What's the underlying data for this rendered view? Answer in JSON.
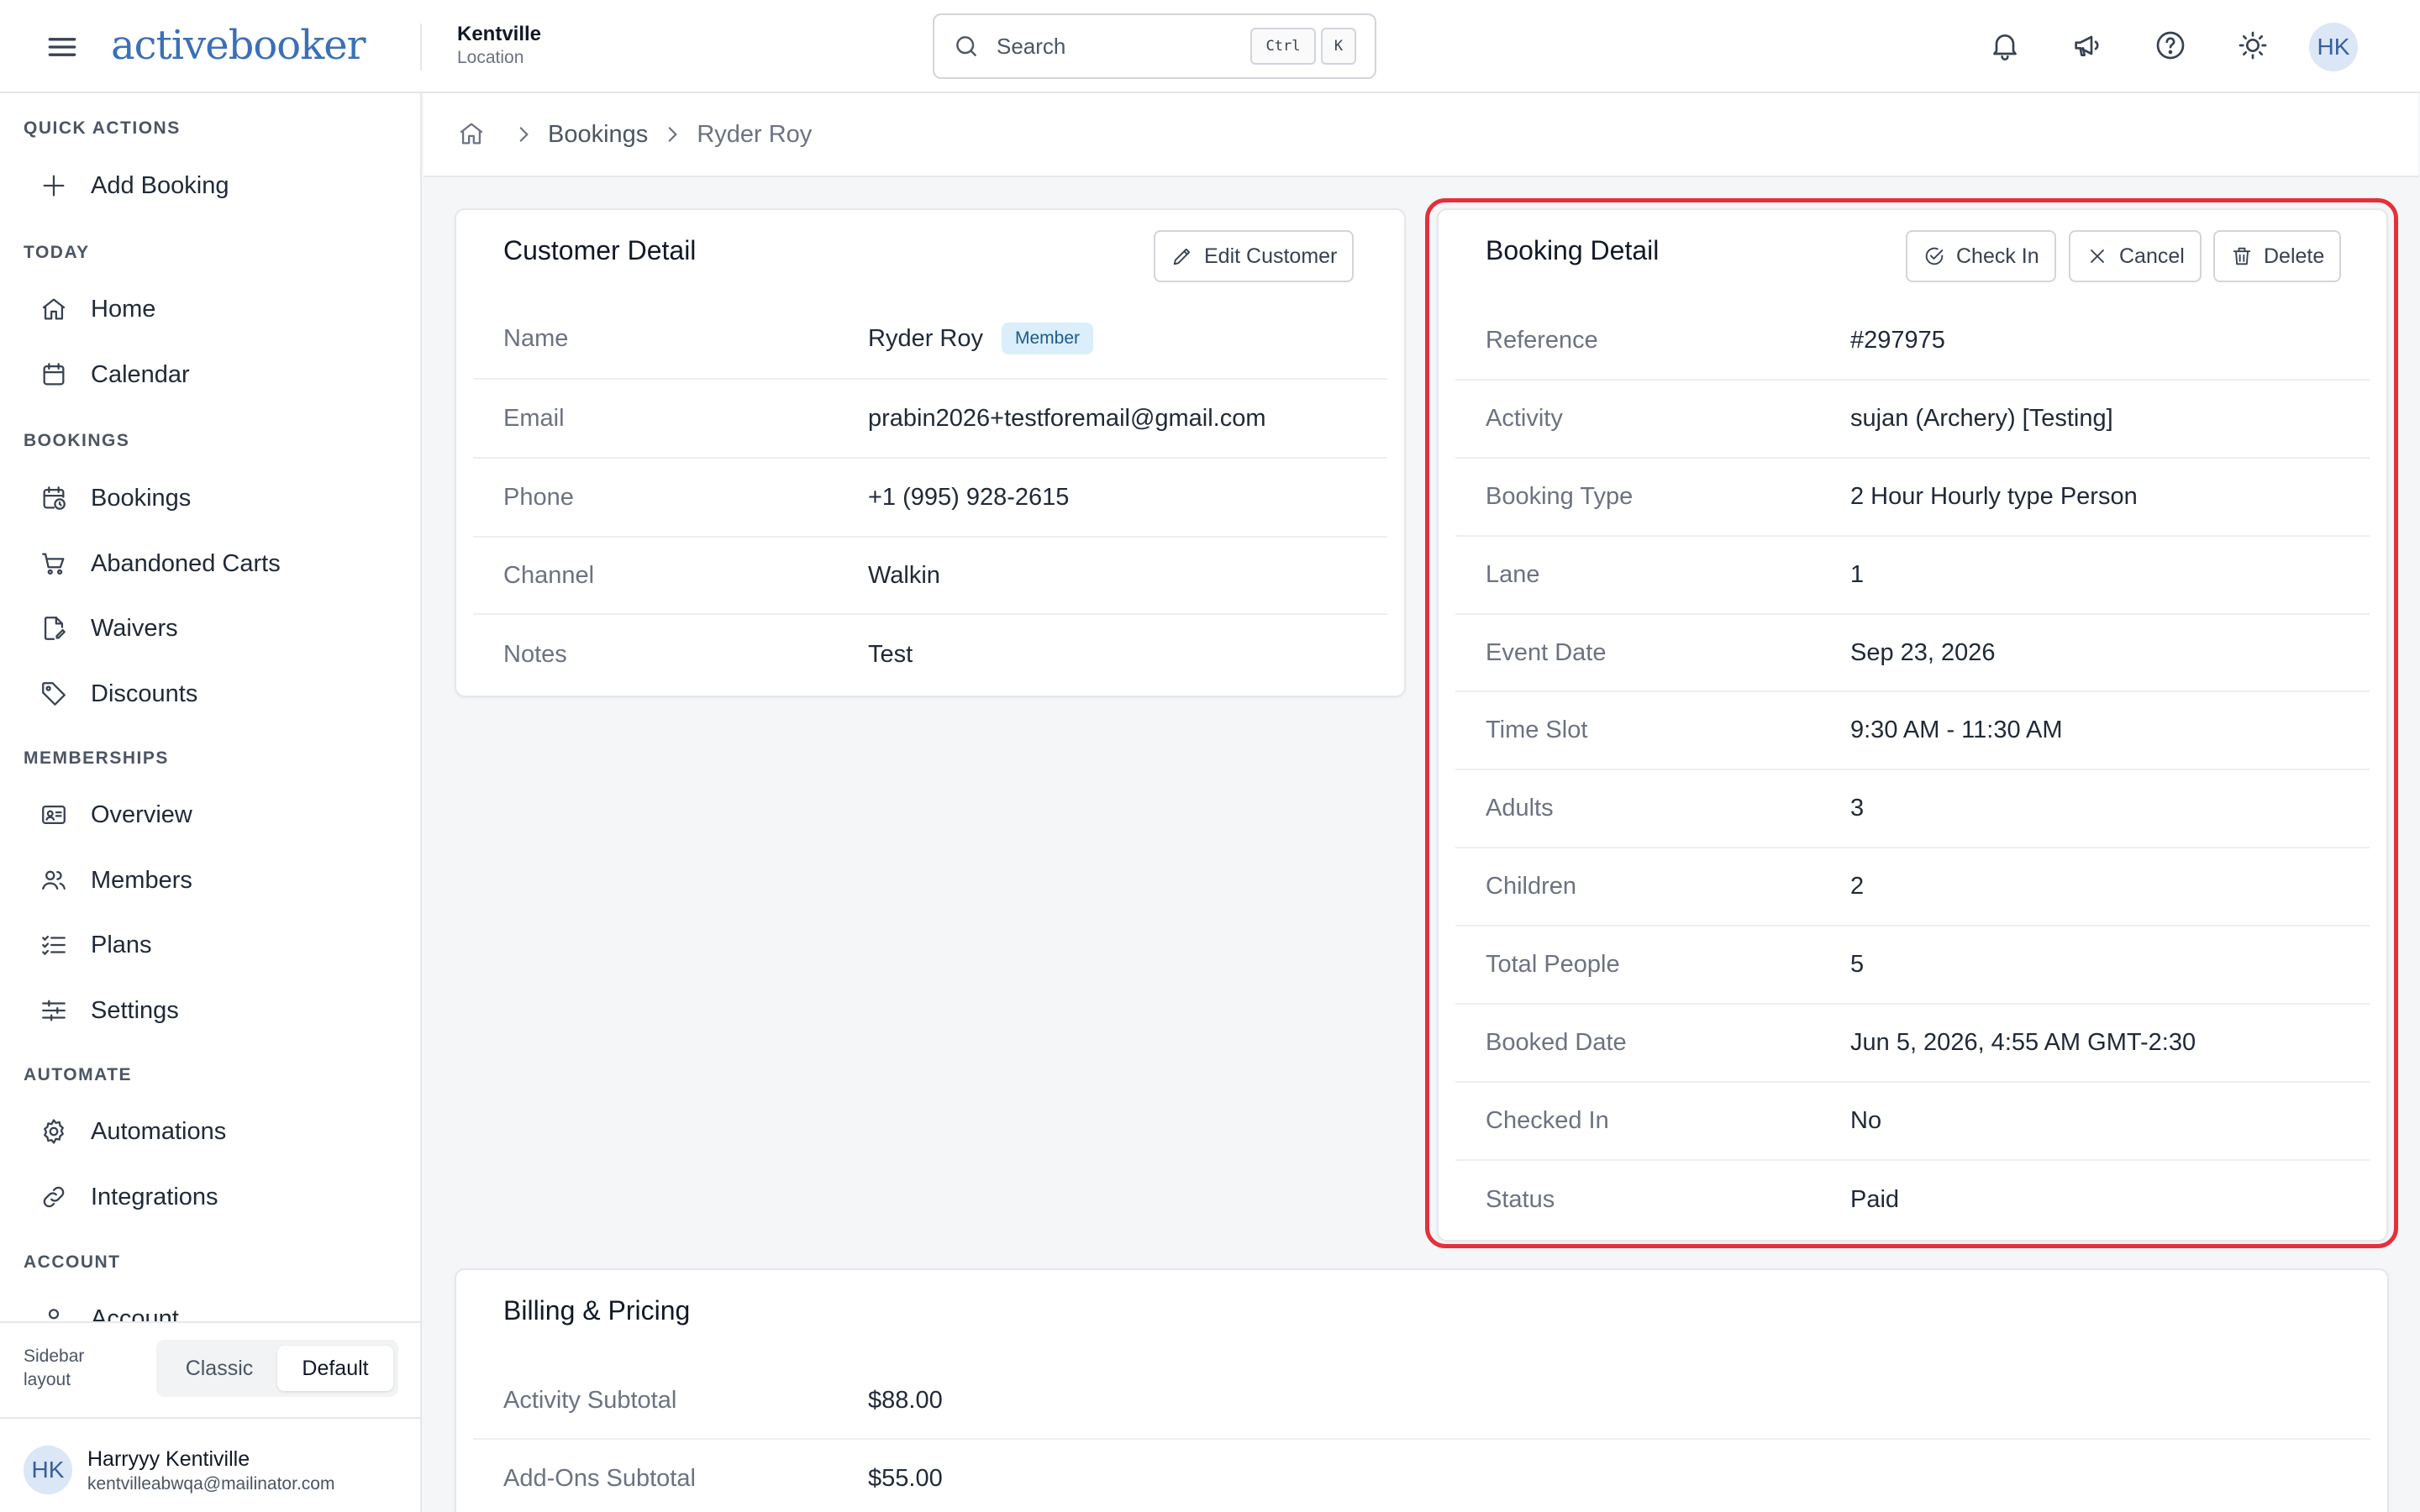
{
  "app": {
    "logo_text": "activebooker",
    "location_name": "Kentville",
    "location_sub": "Location"
  },
  "search": {
    "placeholder": "Search",
    "shortcut_ctrl": "Ctrl",
    "shortcut_key": "K"
  },
  "header_icons": [
    "bell-icon",
    "megaphone-icon",
    "help-icon",
    "sun-icon"
  ],
  "user": {
    "initials": "HK",
    "name": "Harryyy Kentiville",
    "email": "kentvilleabwqa@mailinator.com"
  },
  "sidebar": {
    "sections": {
      "quick_actions": "QUICK ACTIONS",
      "today": "TODAY",
      "bookings": "BOOKINGS",
      "memberships": "MEMBERSHIPS",
      "automate": "AUTOMATE",
      "account": "ACCOUNT"
    },
    "items": {
      "add_booking": "Add Booking",
      "home": "Home",
      "calendar": "Calendar",
      "bookings": "Bookings",
      "abandoned_carts": "Abandoned Carts",
      "waivers": "Waivers",
      "discounts": "Discounts",
      "overview": "Overview",
      "members": "Members",
      "plans": "Plans",
      "settings": "Settings",
      "automations": "Automations",
      "integrations": "Integrations",
      "account": "Account"
    },
    "layout_label": "Sidebar layout",
    "layout_options": [
      "Classic",
      "Default"
    ],
    "layout_selected": "Default"
  },
  "breadcrumb": {
    "items": [
      "Bookings",
      "Ryder Roy"
    ]
  },
  "customer_detail": {
    "title": "Customer Detail",
    "edit_button": "Edit Customer",
    "badge": "Member",
    "rows": [
      {
        "label": "Name",
        "value": "Ryder Roy"
      },
      {
        "label": "Email",
        "value": "prabin2026+testforemail@gmail.com"
      },
      {
        "label": "Phone",
        "value": "+1 (995) 928-2615"
      },
      {
        "label": "Channel",
        "value": "Walkin"
      },
      {
        "label": "Notes",
        "value": "Test"
      }
    ]
  },
  "booking_detail": {
    "title": "Booking Detail",
    "buttons": {
      "check_in": "Check In",
      "cancel": "Cancel",
      "delete": "Delete"
    },
    "rows": [
      {
        "label": "Reference",
        "value": "#297975"
      },
      {
        "label": "Activity",
        "value": "sujan (Archery) [Testing]"
      },
      {
        "label": "Booking Type",
        "value": "2 Hour Hourly type Person"
      },
      {
        "label": "Lane",
        "value": "1"
      },
      {
        "label": "Event Date",
        "value": "Sep 23, 2026"
      },
      {
        "label": "Time Slot",
        "value": "9:30 AM - 11:30 AM"
      },
      {
        "label": "Adults",
        "value": "3"
      },
      {
        "label": "Children",
        "value": "2"
      },
      {
        "label": "Total People",
        "value": "5"
      },
      {
        "label": "Booked Date",
        "value": "Jun 5, 2026, 4:55 AM GMT-2:30"
      },
      {
        "label": "Checked In",
        "value": "No"
      },
      {
        "label": "Status",
        "value": "Paid"
      }
    ]
  },
  "billing": {
    "title": "Billing & Pricing",
    "rows": [
      {
        "label": "Activity Subtotal",
        "value": "$88.00"
      },
      {
        "label": "Add-Ons Subtotal",
        "value": "$55.00"
      }
    ]
  },
  "colors": {
    "accent": "#3b6fb8",
    "highlight": "#e5303a",
    "badge_bg": "#dbeefb"
  }
}
